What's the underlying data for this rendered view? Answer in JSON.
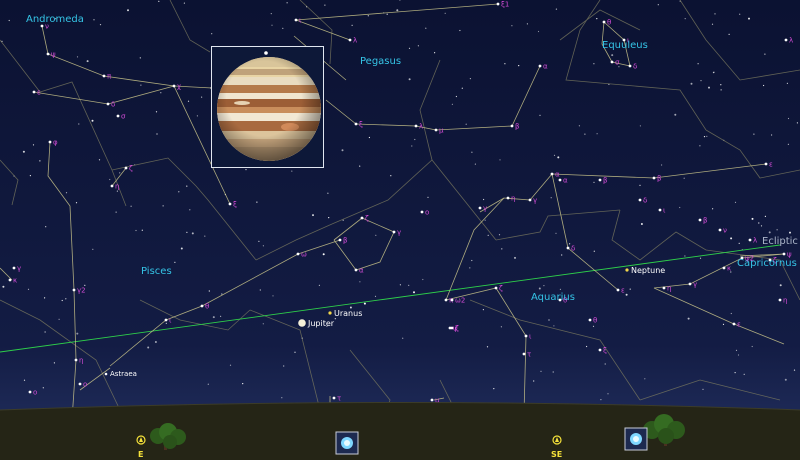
{
  "sky": {
    "colors": {
      "sky_top": "#0c1233",
      "sky_horizon": "#1e2a5c",
      "constellation_line": "#c9c48a",
      "boundary_line": "#8c8b6c",
      "ecliptic": "#2ecf4a",
      "constellation_name": "#35c4e6",
      "star_label": "#d24cd6",
      "planet_label": "#ffffff",
      "ground": "#242414",
      "compass": "#f5e23a"
    },
    "constellation_names": [
      {
        "id": "andromeda",
        "text": "Andromeda"
      },
      {
        "id": "pegasus",
        "text": "Pegasus"
      },
      {
        "id": "equuleus",
        "text": "Equuleus"
      },
      {
        "id": "pisces",
        "text": "Pisces"
      },
      {
        "id": "aquarius",
        "text": "Aquarius"
      },
      {
        "id": "capricornus",
        "text": "Capricornus"
      }
    ],
    "ecliptic_label": "Ecliptic",
    "planets": [
      {
        "id": "jupiter",
        "name": "Jupiter"
      },
      {
        "id": "uranus",
        "name": "Uranus"
      },
      {
        "id": "neptune",
        "name": "Neptune"
      },
      {
        "id": "astraea",
        "name": "Astraea"
      }
    ],
    "star_labels": [
      "ν",
      "ψ",
      "π",
      "δ",
      "ε",
      "σ",
      "ζ",
      "η",
      "φ",
      "λ",
      "ι",
      "ε",
      "ξ",
      "γ",
      "ω",
      "θ",
      "ι",
      "κ",
      "γ2",
      "η",
      "ο",
      "ο",
      "χ",
      "ξ1",
      "α",
      "β",
      "μ",
      "λ",
      "ξ",
      "η",
      "α",
      "β",
      "δ",
      "ε",
      "γ",
      "ο",
      "ζ",
      "γ",
      "β",
      "α",
      "π",
      "ζ",
      "γ",
      "η",
      "ψ2",
      "κ",
      "ψ",
      "ζ",
      "ι",
      "τ",
      "ε",
      "ε",
      "θ",
      "ι",
      "σ",
      "δ",
      "λ",
      "ω2",
      "ψ",
      "μ",
      "τ",
      "γ",
      "α",
      "β",
      "δ",
      "ι",
      "β",
      "ν",
      "λ",
      "ζ",
      "η",
      "θ",
      "θ",
      "ξ"
    ]
  },
  "horizon": {
    "compass": [
      {
        "id": "east",
        "label": "E"
      },
      {
        "id": "southeast",
        "label": "SE"
      }
    ]
  },
  "zoom_inset": {
    "object": "Jupiter"
  }
}
